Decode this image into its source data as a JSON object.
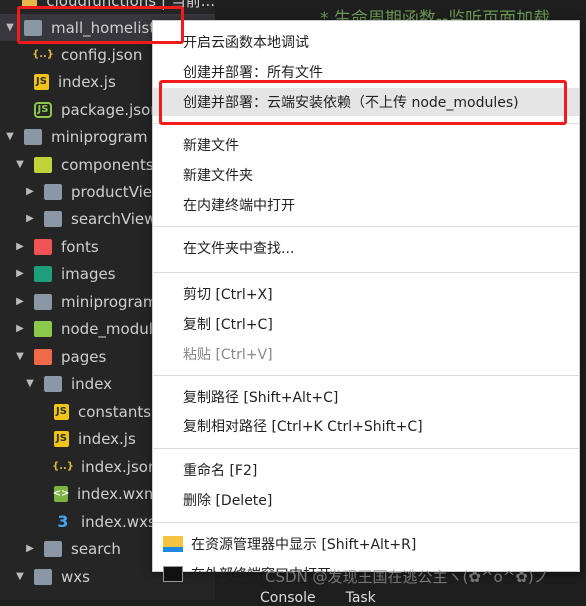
{
  "sidebar": {
    "items": [
      {
        "label": "cloudfunctions | 当前...",
        "indent": 0,
        "arrow": "",
        "icon": "cloud-folder",
        "color": "#e8b84a"
      },
      {
        "label": "mall_homelist",
        "indent": 0,
        "arrow": "▼",
        "icon": "folder-open",
        "color": "#8a98a5"
      },
      {
        "label": "config.json",
        "indent": 1,
        "arrow": "",
        "icon": "json",
        "color": "#e2b93d"
      },
      {
        "label": "index.js",
        "indent": 1,
        "arrow": "",
        "icon": "js",
        "color": "#f0c419"
      },
      {
        "label": "package.json",
        "indent": 1,
        "arrow": "",
        "icon": "nodejs",
        "color": "#8cc84b"
      },
      {
        "label": "miniprogram",
        "indent": 0,
        "arrow": "▼",
        "icon": "folder-open",
        "color": "#8a98a5"
      },
      {
        "label": "components",
        "indent": 1,
        "arrow": "▼",
        "icon": "components-folder",
        "color": "#c0d43a"
      },
      {
        "label": "productView",
        "indent": 2,
        "arrow": "▶",
        "icon": "folder",
        "color": "#8a98a5"
      },
      {
        "label": "searchView",
        "indent": 2,
        "arrow": "▶",
        "icon": "folder",
        "color": "#8a98a5"
      },
      {
        "label": "fonts",
        "indent": 1,
        "arrow": "▶",
        "icon": "fonts-folder",
        "color": "#f05454"
      },
      {
        "label": "images",
        "indent": 1,
        "arrow": "▶",
        "icon": "images-folder",
        "color": "#1e9e7a"
      },
      {
        "label": "miniprogram_",
        "indent": 1,
        "arrow": "▶",
        "icon": "folder",
        "color": "#8a98a5"
      },
      {
        "label": "node_modules",
        "indent": 1,
        "arrow": "▶",
        "icon": "node-folder",
        "color": "#8cc84b"
      },
      {
        "label": "pages",
        "indent": 1,
        "arrow": "▼",
        "icon": "pages-folder",
        "color": "#f06a4a"
      },
      {
        "label": "index",
        "indent": 2,
        "arrow": "▼",
        "icon": "folder-open",
        "color": "#8a98a5"
      },
      {
        "label": "constants.js",
        "indent": 3,
        "arrow": "",
        "icon": "js",
        "color": "#f0c419"
      },
      {
        "label": "index.js",
        "indent": 3,
        "arrow": "",
        "icon": "js",
        "color": "#f0c419"
      },
      {
        "label": "index.json",
        "indent": 3,
        "arrow": "",
        "icon": "json",
        "color": "#e2b93d"
      },
      {
        "label": "index.wxml",
        "indent": 3,
        "arrow": "",
        "icon": "wxml",
        "color": "#7cb342"
      },
      {
        "label": "index.wxss",
        "indent": 3,
        "arrow": "",
        "icon": "css",
        "color": "#42a5f5"
      },
      {
        "label": "search",
        "indent": 2,
        "arrow": "▶",
        "icon": "folder",
        "color": "#8a98a5"
      },
      {
        "label": "wxs",
        "indent": 1,
        "arrow": "▼",
        "icon": "folder-open",
        "color": "#8a98a5"
      }
    ]
  },
  "editor": {
    "comment": "* 生命周期函数--监听页面加载",
    "bottom_tabs": [
      "Console",
      "Task"
    ]
  },
  "menu": {
    "items": [
      {
        "label": "开启云函数本地调试"
      },
      {
        "label": "创建并部署：所有文件"
      },
      {
        "label": "创建并部署：云端安装依赖（不上传 node_modules)",
        "highlighted": true
      },
      {
        "label": "新建文件",
        "sep_before": true
      },
      {
        "label": "新建文件夹"
      },
      {
        "label": "在内建终端中打开"
      },
      {
        "label": "在文件夹中查找...",
        "sep_before": true
      },
      {
        "label": "剪切  [Ctrl+X]",
        "sep_before": true
      },
      {
        "label": "复制  [Ctrl+C]"
      },
      {
        "label": "粘贴  [Ctrl+V]",
        "disabled": true
      },
      {
        "label": "复制路径  [Shift+Alt+C]",
        "sep_before": true
      },
      {
        "label": "复制相对路径  [Ctrl+K Ctrl+Shift+C]"
      },
      {
        "label": "重命名  [F2]",
        "sep_before": true
      },
      {
        "label": "删除  [Delete]"
      },
      {
        "label": "在资源管理器中显示  [Shift+Alt+R]",
        "sep_before": true,
        "icon": "explorer-folder-icon"
      },
      {
        "label": "在外部终端窗口中打开",
        "icon": "terminal-icon"
      }
    ]
  },
  "watermark": "CSDN @发现王国在逃公主ヽ(✿^o^✿)ノ",
  "annotation_color": "#f21a1a"
}
